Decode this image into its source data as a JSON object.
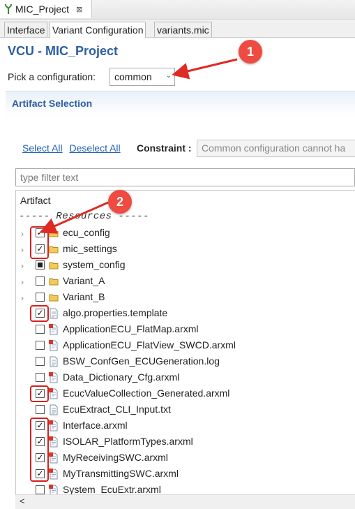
{
  "editor_tab": {
    "title": "MIC_Project",
    "close": "⊠"
  },
  "subtabs": [
    "Interface",
    "Variant Configuration",
    "variants.mic"
  ],
  "page_title": "VCU - MIC_Project",
  "config": {
    "label": "Pick a configuration:",
    "value": "common"
  },
  "section_title": "Artifact Selection",
  "links": {
    "select_all": "Select All",
    "deselect_all": "Deselect All"
  },
  "constraint": {
    "label": "Constraint :",
    "value": "Common configuration cannot ha"
  },
  "filter_placeholder": "type filter text",
  "tree": {
    "column_header": "Artifact",
    "resources_header": "----- Resources -----",
    "items": [
      {
        "name": "ecu_config",
        "type": "folder",
        "expandable": true,
        "state": "checked"
      },
      {
        "name": "mic_settings",
        "type": "folder",
        "expandable": true,
        "state": "checked"
      },
      {
        "name": "system_config",
        "type": "folder",
        "expandable": true,
        "state": "partial"
      },
      {
        "name": "Variant_A",
        "type": "folder",
        "expandable": true,
        "state": "unchecked"
      },
      {
        "name": "Variant_B",
        "type": "folder",
        "expandable": true,
        "state": "unchecked"
      },
      {
        "name": "algo.properties.template",
        "type": "file",
        "expandable": false,
        "state": "checked"
      },
      {
        "name": "ApplicationECU_FlatMap.arxml",
        "type": "arxml",
        "expandable": false,
        "state": "unchecked"
      },
      {
        "name": "ApplicationECU_FlatView_SWCD.arxml",
        "type": "arxml",
        "expandable": false,
        "state": "unchecked"
      },
      {
        "name": "BSW_ConfGen_ECUGeneration.log",
        "type": "file",
        "expandable": false,
        "state": "unchecked"
      },
      {
        "name": "Data_Dictionary_Cfg.arxml",
        "type": "arxml",
        "expandable": false,
        "state": "unchecked"
      },
      {
        "name": "EcucValueCollection_Generated.arxml",
        "type": "arxml",
        "expandable": false,
        "state": "checked"
      },
      {
        "name": "EcuExtract_CLI_Input.txt",
        "type": "file",
        "expandable": false,
        "state": "unchecked"
      },
      {
        "name": "Interface.arxml",
        "type": "arxml",
        "expandable": false,
        "state": "checked"
      },
      {
        "name": "ISOLAR_PlatformTypes.arxml",
        "type": "arxml",
        "expandable": false,
        "state": "checked"
      },
      {
        "name": "MyReceivingSWC.arxml",
        "type": "arxml",
        "expandable": false,
        "state": "checked"
      },
      {
        "name": "MyTransmittingSWC.arxml",
        "type": "arxml",
        "expandable": false,
        "state": "checked"
      },
      {
        "name": "System_EcuExtr.arxml",
        "type": "arxml",
        "expandable": false,
        "state": "unchecked"
      }
    ]
  },
  "callouts": [
    "1",
    "2"
  ],
  "colors": {
    "accent": "#2c5ea3",
    "annotation": "#ef4b40"
  }
}
